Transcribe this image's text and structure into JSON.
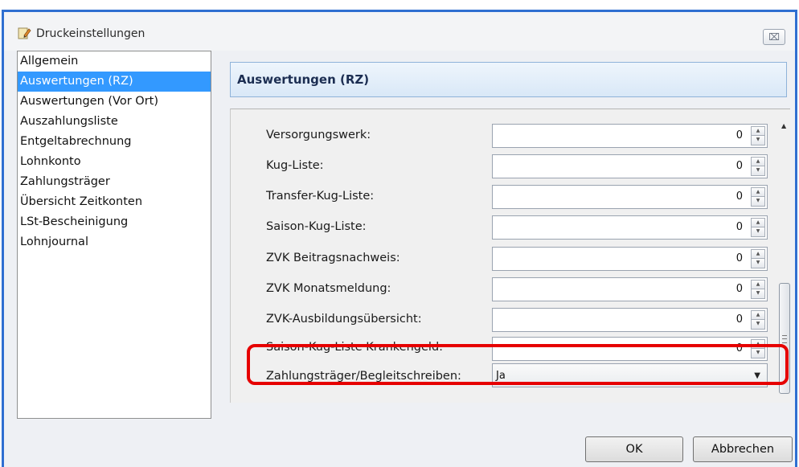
{
  "window": {
    "title": "Druckeinstellungen",
    "close_label": "⌧"
  },
  "sidebar": {
    "items": [
      {
        "label": "Allgemein",
        "selected": false
      },
      {
        "label": "Auswertungen (RZ)",
        "selected": true
      },
      {
        "label": "Auswertungen (Vor Ort)",
        "selected": false
      },
      {
        "label": "Auszahlungsliste",
        "selected": false
      },
      {
        "label": "Entgeltabrechnung",
        "selected": false
      },
      {
        "label": "Lohnkonto",
        "selected": false
      },
      {
        "label": "Zahlungsträger",
        "selected": false
      },
      {
        "label": "Übersicht Zeitkonten",
        "selected": false
      },
      {
        "label": "LSt-Bescheinigung",
        "selected": false
      },
      {
        "label": "Lohnjournal",
        "selected": false
      }
    ]
  },
  "panel": {
    "title": "Auswertungen (RZ)"
  },
  "form": {
    "rows": [
      {
        "label": "Versorgungswerk:",
        "value": "0"
      },
      {
        "label": "Kug-Liste:",
        "value": "0"
      },
      {
        "label": "Transfer-Kug-Liste:",
        "value": "0"
      },
      {
        "label": "Saison-Kug-Liste:",
        "value": "0"
      },
      {
        "label": "ZVK Beitragsnachweis:",
        "value": "0"
      },
      {
        "label": "ZVK Monatsmeldung:",
        "value": "0"
      },
      {
        "label": "ZVK-Ausbildungsübersicht:",
        "value": "0"
      },
      {
        "label": "Saison-Kug-Liste Krankengeld:",
        "value": "0"
      }
    ],
    "combo": {
      "label": "Zahlungsträger/Begleitschreiben:",
      "value": "Ja"
    }
  },
  "buttons": {
    "ok": "OK",
    "cancel": "Abbrechen"
  },
  "colors": {
    "selection": "#3399ff",
    "highlight": "#e60000",
    "window_border": "#2f6fd1"
  }
}
